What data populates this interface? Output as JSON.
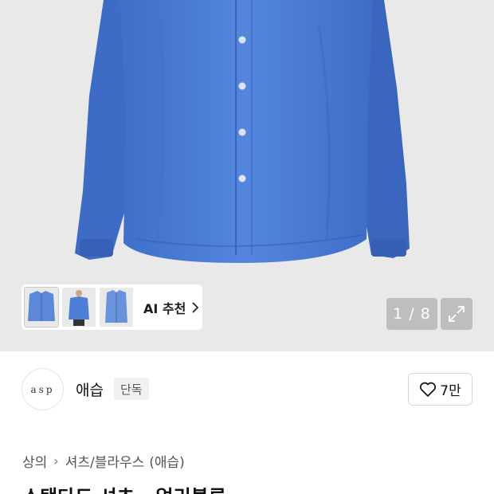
{
  "gallery": {
    "ai_recommend_label": "AI 추천",
    "counter": "1 / 8",
    "thumbnails": [
      "shirt-front-thumbnail",
      "shirt-model-thumbnail",
      "shirt-detail-thumbnail"
    ],
    "shirt_color": "#4f7fd8"
  },
  "brand": {
    "logo_text": "asp",
    "name": "애습",
    "tag": "단독",
    "like_count": "7만"
  },
  "breadcrumb": {
    "category": "상의",
    "subcategory": "셔츠/블라우스",
    "brand": "(애습)"
  },
  "product": {
    "title": "스탠다드 셔츠 - 얼리블루"
  }
}
